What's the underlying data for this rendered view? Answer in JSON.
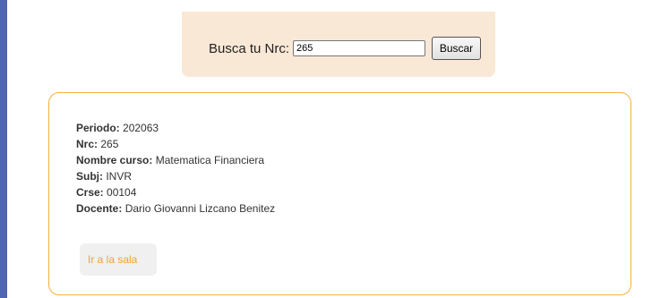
{
  "search": {
    "label": "Busca tu Nrc:",
    "value": "265",
    "button_label": "Buscar"
  },
  "course": {
    "periodo_label": "Periodo:",
    "periodo": "202063",
    "nrc_label": "Nrc:",
    "nrc": "265",
    "nombre_label": "Nombre curso:",
    "nombre": "Matematica Financiera",
    "subj_label": "Subj:",
    "subj": "INVR",
    "crse_label": "Crse:",
    "crse": "00104",
    "docente_label": "Docente:",
    "docente": "Dario Giovanni Lizcano Benitez",
    "link_label": "Ir a la sala"
  },
  "colors": {
    "page_background": "#5166b0",
    "search_panel": "#fae8d6",
    "card_border": "#f7b03e",
    "link_text": "#f7a12c"
  }
}
